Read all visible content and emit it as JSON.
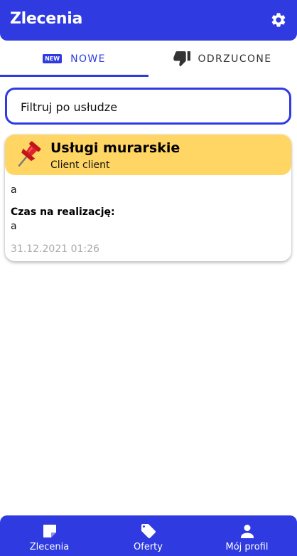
{
  "app_bar": {
    "title": "Zlecenia",
    "settings_icon": "gear-icon"
  },
  "tabs": [
    {
      "badge": "NEW",
      "label": "NOWE",
      "icon": "new-badge-icon",
      "selected": true
    },
    {
      "label": "ODRZUCONE",
      "icon": "thumbs-down-icon",
      "selected": false
    }
  ],
  "filter": {
    "placeholder": "Filtruj po usłudze"
  },
  "orders": [
    {
      "icon": "pushpin-icon",
      "service": "Usługi murarskie",
      "client": "Client client",
      "description": "a",
      "time_label": "Czas na realizację:",
      "time_value": "a",
      "date": "31.12.2021 01:26"
    }
  ],
  "bottom_nav": [
    {
      "label": "Zlecenia",
      "icon": "note-icon"
    },
    {
      "label": "Oferty",
      "icon": "tag-icon"
    },
    {
      "label": "Mój profil",
      "icon": "person-icon"
    }
  ],
  "colors": {
    "primary": "#2f3be0",
    "card_header": "#ffd563",
    "date_text": "#a9a9a9"
  }
}
